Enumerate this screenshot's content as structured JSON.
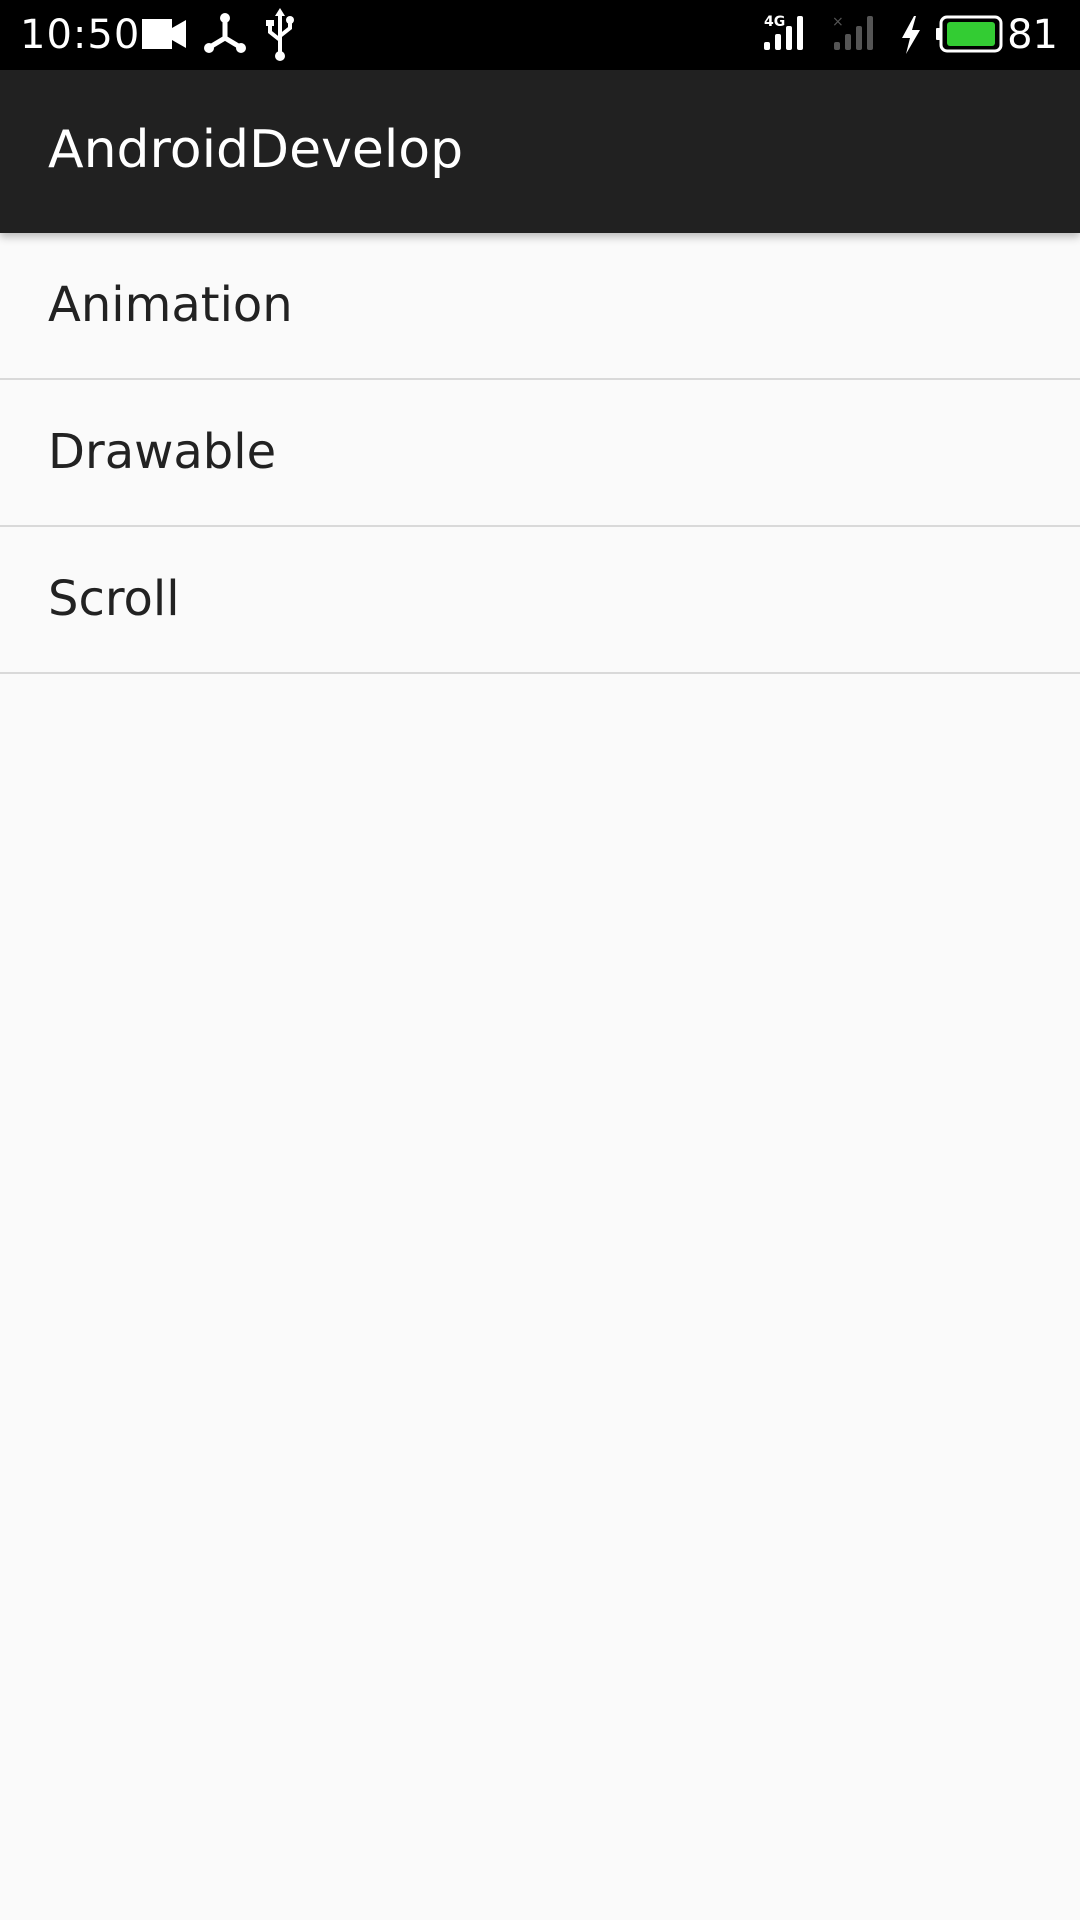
{
  "status_bar": {
    "time": "10:50",
    "left_icons": [
      "video-camera-icon",
      "share-node-icon",
      "usb-icon"
    ],
    "right_icons": [
      "signal-4g-icon",
      "signal-none-icon",
      "charging-bolt-icon",
      "battery-icon"
    ],
    "battery_level": "81",
    "battery_color": "#33cc33"
  },
  "app_bar": {
    "title": "AndroidDevelop",
    "background": "#212121"
  },
  "list": {
    "items": [
      {
        "label": "Animation"
      },
      {
        "label": "Drawable"
      },
      {
        "label": "Scroll"
      }
    ]
  }
}
